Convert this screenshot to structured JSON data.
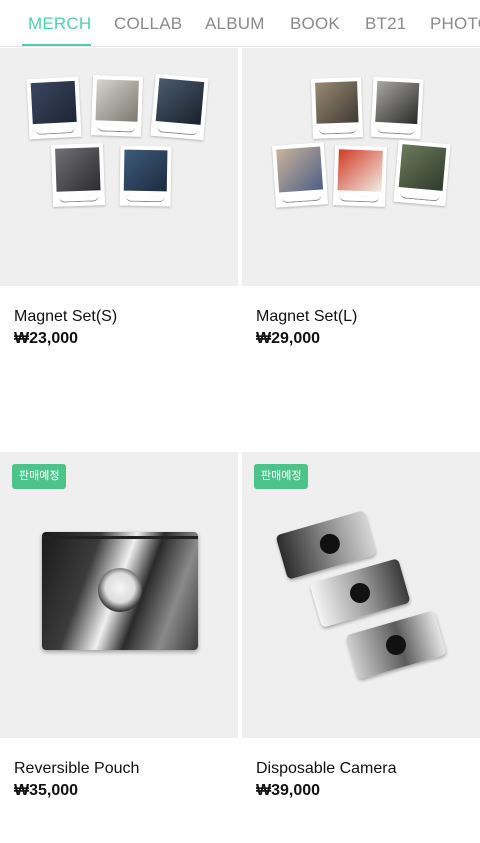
{
  "tabs": [
    {
      "label": "MERCH",
      "active": true
    },
    {
      "label": "COLLAB",
      "active": false
    },
    {
      "label": "ALBUM",
      "active": false
    },
    {
      "label": "BOOK",
      "active": false
    },
    {
      "label": "BT21",
      "active": false
    },
    {
      "label": "PHOTO",
      "active": false
    }
  ],
  "products": [
    {
      "name": "Magnet Set(S)",
      "price": "₩23,000",
      "badge": ""
    },
    {
      "name": "Magnet Set(L)",
      "price": "₩29,000",
      "badge": ""
    },
    {
      "name": "Reversible Pouch",
      "price": "₩35,000",
      "badge": "판매예정"
    },
    {
      "name": "Disposable Camera",
      "price": "₩39,000",
      "badge": "판매예정"
    }
  ],
  "colors": {
    "accent": "#4fcfae",
    "badge": "#4cc489",
    "thumb_bg": "#efefef"
  }
}
